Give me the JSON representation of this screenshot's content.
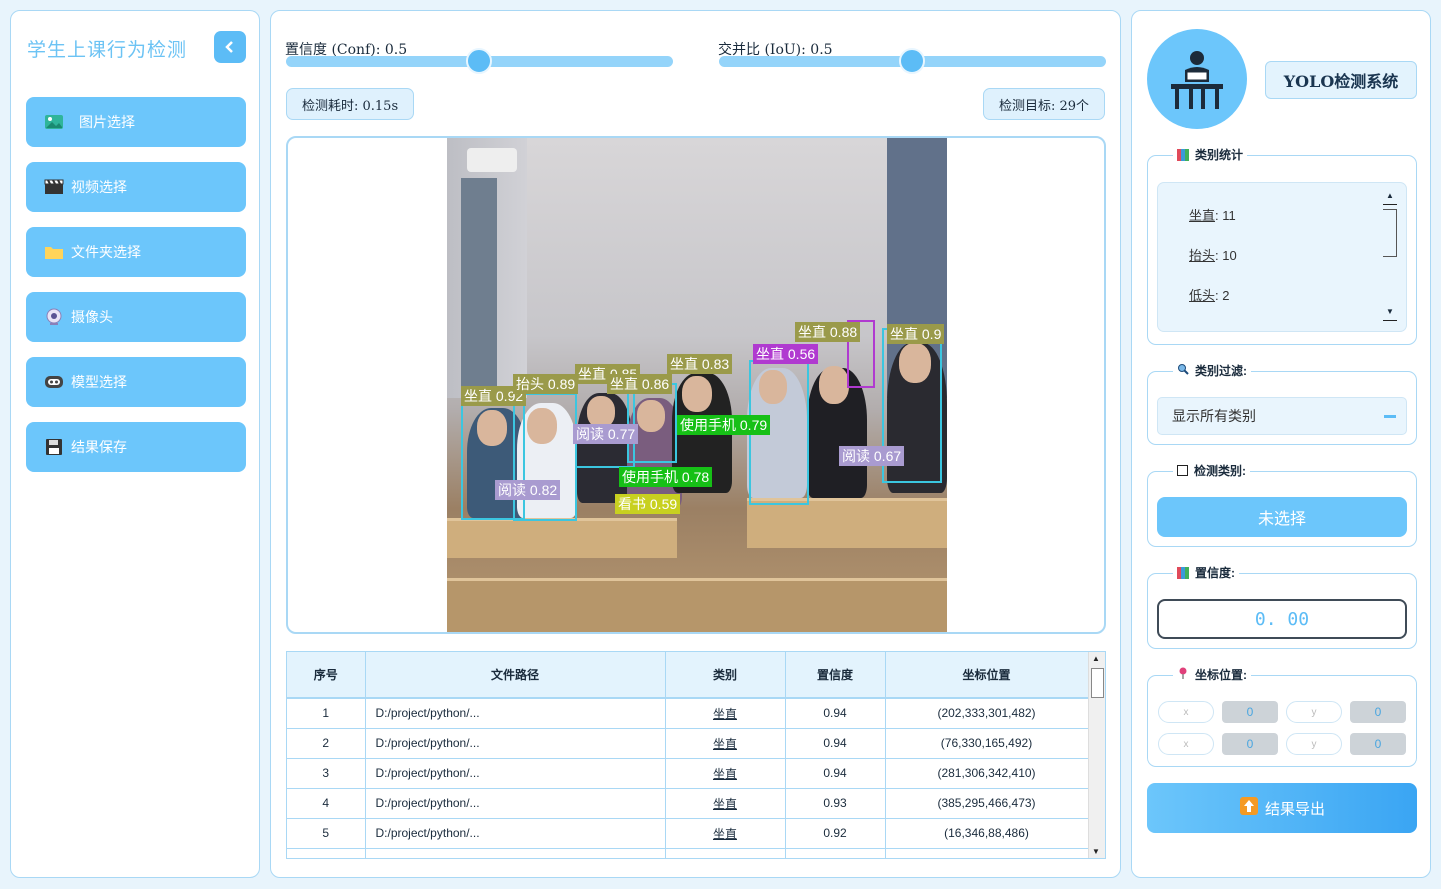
{
  "app": {
    "title": "学生上课行为检测",
    "collapse_icon": "chevron-left-icon"
  },
  "nav": [
    {
      "label": "图片选择",
      "icon": "image-icon"
    },
    {
      "label": "视频选择",
      "icon": "clapperboard-icon"
    },
    {
      "label": "文件夹选择",
      "icon": "folder-icon"
    },
    {
      "label": "摄像头",
      "icon": "webcam-icon"
    },
    {
      "label": "模型选择",
      "icon": "robot-icon"
    },
    {
      "label": "结果保存",
      "icon": "floppy-icon"
    }
  ],
  "sliders": {
    "conf_label": "置信度 (Conf): 0.5",
    "conf_value": 0.5,
    "iou_label": "交并比 (IoU): 0.5",
    "iou_value": 0.5
  },
  "info": {
    "time": "检测耗时: 0.15s",
    "targets": "检测目标: 29个"
  },
  "detections": [
    {
      "label": "坐直 0.92",
      "color": "#9a9a4a"
    },
    {
      "label": "抬头 0.89",
      "color": "#9a9a4a"
    },
    {
      "label": "坐直 0.85",
      "color": "#9a9a4a"
    },
    {
      "label": "坐直 0.86",
      "color": "#9a9a4a"
    },
    {
      "label": "坐直 0.83",
      "color": "#9a9a4a"
    },
    {
      "label": "坐直 0.56",
      "color": "#b03ad0"
    },
    {
      "label": "坐直 0.88",
      "color": "#9a9a4a"
    },
    {
      "label": "坐直 0.9",
      "color": "#9a9a4a"
    },
    {
      "label": "阅读 0.77",
      "color": "#a99bd0"
    },
    {
      "label": "使用手机 0.79",
      "color": "#16c016"
    },
    {
      "label": "阅读 0.67",
      "color": "#a99bd0"
    },
    {
      "label": "使用手机 0.78",
      "color": "#16c016"
    },
    {
      "label": "阅读 0.82",
      "color": "#a99bd0"
    },
    {
      "label": "看书 0.59",
      "color": "#c8d020"
    }
  ],
  "table": {
    "headers": [
      "序号",
      "文件路径",
      "类别",
      "置信度",
      "坐标位置"
    ],
    "rows": [
      [
        "1",
        "D:/project/python/...",
        "坐直",
        "0.94",
        "(202,333,301,482)"
      ],
      [
        "2",
        "D:/project/python/...",
        "坐直",
        "0.94",
        "(76,330,165,492)"
      ],
      [
        "3",
        "D:/project/python/...",
        "坐直",
        "0.94",
        "(281,306,342,410)"
      ],
      [
        "4",
        "D:/project/python/...",
        "坐直",
        "0.93",
        "(385,295,466,473)"
      ],
      [
        "5",
        "D:/project/python/...",
        "坐直",
        "0.92",
        "(16,346,88,486)"
      ],
      [
        "",
        "",
        "",
        "",
        ""
      ]
    ]
  },
  "right": {
    "system_title": "YOLO检测系统",
    "avatar_icon": "student-desk-icon",
    "stats_title": "类别统计",
    "stats": [
      {
        "key": "坐直",
        "value": ": 11"
      },
      {
        "key": "抬头",
        "value": ": 10"
      },
      {
        "key": "低头",
        "value": ": 2"
      }
    ],
    "filter_title": "类别过滤:",
    "filter_value": "显示所有类别",
    "detect_title": "检测类别:",
    "detect_button": "未选择",
    "conf_title": "置信度:",
    "conf_value": "0. 00",
    "coord_title": "坐标位置:",
    "coords": [
      {
        "label": "x",
        "value": "0"
      },
      {
        "label": "y",
        "value": "0"
      },
      {
        "label": "x",
        "value": "0"
      },
      {
        "label": "y",
        "value": "0"
      }
    ],
    "export_label": "结果导出"
  },
  "colors": {
    "accent": "#6cc6fb",
    "accent_dark": "#5cbcf6",
    "border": "#a9d8f5",
    "background": "#e8f4fc"
  }
}
